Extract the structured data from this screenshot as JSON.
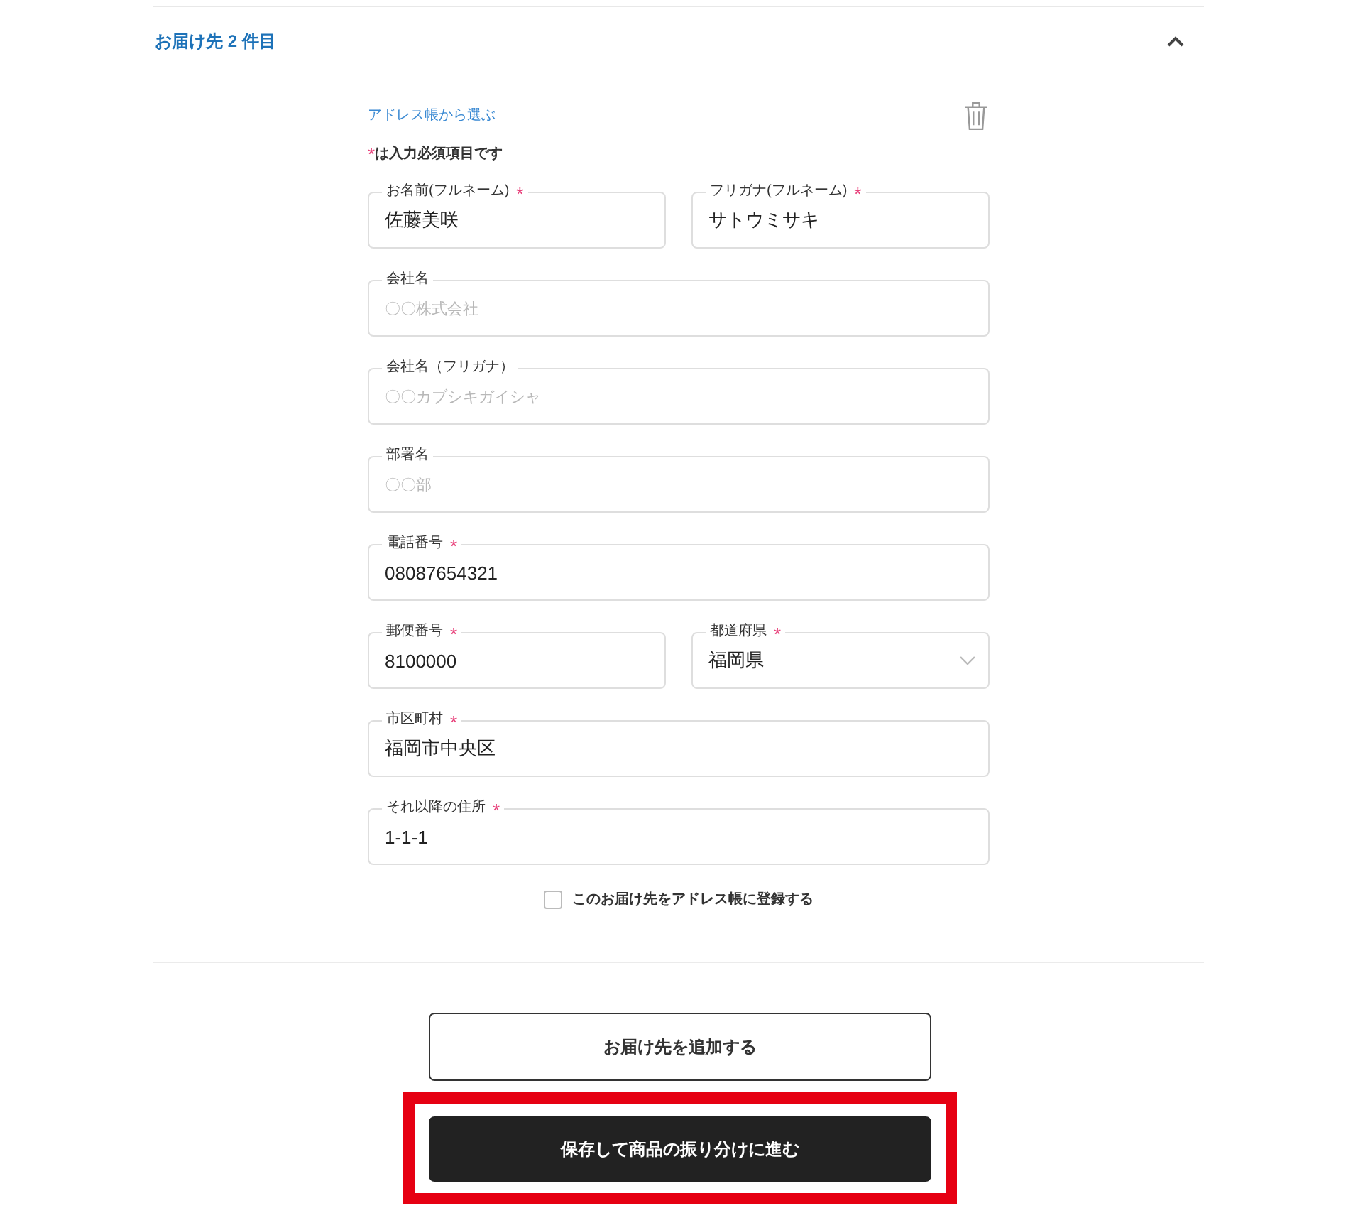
{
  "section": {
    "title": "お届け先 2 件目",
    "expanded": true
  },
  "address_book_link": "アドレス帳から選ぶ",
  "required_note": {
    "mark": "*",
    "text": "は入力必須項目です"
  },
  "form_rows": [
    [
      {
        "kind": "text",
        "label": "お名前(フルネーム)",
        "required_mark": "*",
        "value": "佐藤美咲"
      },
      {
        "kind": "text",
        "label": "フリガナ(フルネーム)",
        "required_mark": "*",
        "value": "サトウミサキ"
      }
    ],
    [
      {
        "kind": "text",
        "label": "会社名",
        "placeholder": "〇〇株式会社"
      }
    ],
    [
      {
        "kind": "text",
        "label": "会社名（フリガナ）",
        "placeholder": "〇〇カブシキガイシャ"
      }
    ],
    [
      {
        "kind": "text",
        "label": "部署名",
        "placeholder": "〇〇部"
      }
    ],
    [
      {
        "kind": "text",
        "label": "電話番号",
        "required_mark": "*",
        "value": "08087654321"
      }
    ],
    [
      {
        "kind": "text",
        "label": "郵便番号",
        "required_mark": "*",
        "value": "8100000"
      },
      {
        "kind": "select",
        "label": "都道府県",
        "required_mark": "*",
        "value": "福岡県"
      }
    ],
    [
      {
        "kind": "text",
        "label": "市区町村",
        "required_mark": "*",
        "value": "福岡市中央区"
      }
    ],
    [
      {
        "kind": "text",
        "label": "それ以降の住所",
        "required_mark": "*",
        "value": "1-1-1"
      }
    ]
  ],
  "save_to_address_book": {
    "label": "このお届け先をアドレス帳に登録する",
    "checked": false
  },
  "buttons": [
    {
      "kind": "outline",
      "label": "お届け先を追加する",
      "highlighted": false
    },
    {
      "kind": "primary",
      "label": "保存して商品の振り分けに進む",
      "highlighted": true
    }
  ]
}
